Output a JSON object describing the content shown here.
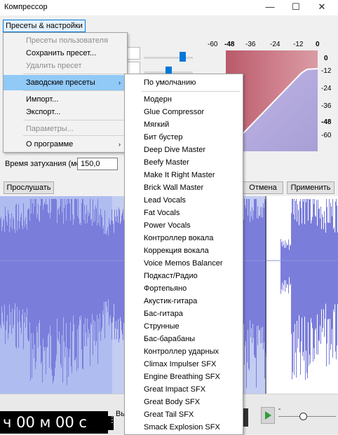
{
  "window": {
    "title": "Компрессор",
    "minimize_glyph": "—",
    "maximize_glyph": "☐",
    "close_glyph": "✕"
  },
  "toolbar": {
    "presets_button": "Пресеты & настройки"
  },
  "graph": {
    "top_scale": [
      "-60",
      "-48",
      "-36",
      "-24",
      "-12",
      "0"
    ],
    "right_scale": [
      "0",
      "-12",
      "-24",
      "-36",
      "-48",
      "-60"
    ]
  },
  "controls": {
    "release_label": "Время затухания (мс)",
    "release_value": "150,0",
    "preview_button": "Прослушать",
    "cancel_button": "Отмена",
    "apply_button": "Применить"
  },
  "menu": {
    "items": [
      {
        "label": "Пресеты пользователя",
        "disabled": true
      },
      {
        "label": "Сохранить пресет...",
        "disabled": false
      },
      {
        "label": "Удалить пресет",
        "disabled": true
      },
      {
        "label": "Заводские пресеты",
        "disabled": false,
        "submenu": true,
        "highlighted": true
      },
      {
        "label": "Импорт...",
        "disabled": false
      },
      {
        "label": "Экспорт...",
        "disabled": false
      },
      {
        "label": "Параметры...",
        "disabled": true
      },
      {
        "label": "О программе",
        "disabled": false,
        "submenu": true
      }
    ],
    "submenu_arrow": "›"
  },
  "factory_presets": {
    "default": "По умолчанию",
    "items": [
      "Модерн",
      "Glue Compressor",
      "Мягкий",
      "Бит бустер",
      "Deep Dive Master",
      "Beefy Master",
      "Make It Right Master",
      "Brick Wall Master",
      "Lead Vocals",
      "Fat Vocals",
      "Power Vocals",
      "Контроллер вокала",
      "Коррекция вокала",
      "Voice Memos Balancer",
      "Подкаст/Радио",
      "Фортепьяно",
      "Акустик-гитара",
      "Бас-гитара",
      "Струнные",
      "Бас-барабаны",
      "Контроллер ударных",
      "Climax Impulser SFX",
      "Engine Breathing SFX",
      "Great Impact SFX",
      "Great Body SFX",
      "Great Tail SFX",
      "Smack Explosion SFX"
    ]
  },
  "bottom": {
    "timecode": "ч 00 м 00 с",
    "truncated_label": "Вы",
    "slider_min_glyph": "-"
  },
  "colors": {
    "accent": "#0078d7",
    "waveform": "#7b7ddb",
    "graph_red": "#c76a78",
    "graph_lavender": "#b7aedc",
    "menu_highlight": "#91c9f7"
  }
}
